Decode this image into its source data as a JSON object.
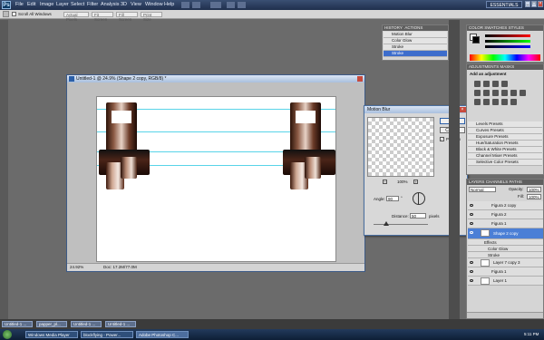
{
  "app": {
    "menu": [
      "File",
      "Edit",
      "Image",
      "Layer",
      "Select",
      "Filter",
      "Analysis",
      "3D",
      "View",
      "Window",
      "Help"
    ],
    "workspace": "ESSENTIALS"
  },
  "options_bar": {
    "scroll_all_windows": "Scroll All Windows",
    "buttons": [
      "Actual Pixels",
      "Fit Screen",
      "Fill Screen",
      "Print Size"
    ]
  },
  "document": {
    "title": "Untitled-1 @ 24.9% (Shape 2 copy, RGB/8) *",
    "zoom": "24.92%",
    "doc_size": "Doc: 17.2M/77.0M"
  },
  "motion_blur": {
    "title": "Motion Blur",
    "ok": "OK",
    "cancel": "Cancel",
    "preview_label": "Preview",
    "preview_zoom": "100%",
    "angle_label": "Angle:",
    "angle_value": "90",
    "angle_unit": "°",
    "distance_label": "Distance:",
    "distance_value": "50",
    "distance_unit": "pixels"
  },
  "history": {
    "tabs": [
      "HISTORY",
      "ACTIONS"
    ],
    "items": [
      "Motion Blur",
      "Color Glow",
      "Stroke",
      "Stroke"
    ],
    "selected_index": 3
  },
  "color_panel": {
    "tabs": [
      "COLOR",
      "SWATCHES",
      "STYLES"
    ]
  },
  "adjustments": {
    "tabs": [
      "ADJUSTMENTS",
      "MASKS"
    ],
    "heading": "Add an adjustment",
    "presets": [
      "Levels Presets",
      "Curves Presets",
      "Exposure Presets",
      "Hue/Saturation Presets",
      "Black & White Presets",
      "Channel Mixer Presets",
      "Selective Color Presets"
    ]
  },
  "layers": {
    "tabs": [
      "LAYERS",
      "CHANNELS",
      "PATHS"
    ],
    "blend_mode": "Normal",
    "opacity_label": "Opacity:",
    "opacity_value": "100%",
    "fill_label": "Fill:",
    "fill_value": "100%",
    "items": [
      {
        "name": "Figura 2 copy"
      },
      {
        "name": "Figura 2"
      },
      {
        "name": "Figura 1"
      },
      {
        "name": "Shape 2 copy"
      },
      {
        "name": "Effects"
      },
      {
        "name": "Color Glow"
      },
      {
        "name": "Stroke"
      },
      {
        "name": "Layer 7 copy 3"
      },
      {
        "name": "Figura 1"
      },
      {
        "name": "Layer 1"
      }
    ],
    "selected_index": 3
  },
  "taskbar_docs": [
    "Untitled-1 ...",
    "papper_pl...",
    "Untitled-1 ...",
    "Untitled-1 ..."
  ],
  "taskbar": {
    "buttons": [
      "Windows Media Player",
      "blockflying - Power...",
      "Adobe Photoshop C..."
    ],
    "clock": "5:11 PM"
  }
}
